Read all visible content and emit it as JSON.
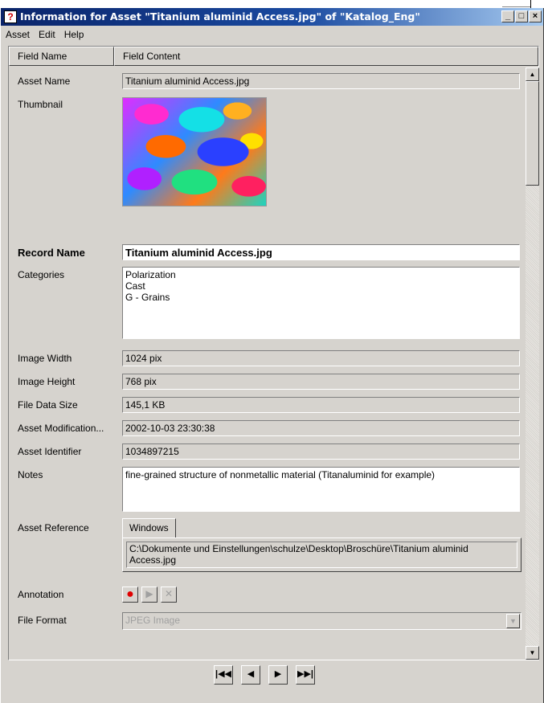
{
  "window": {
    "title": "Information for Asset \"Titanium aluminid Access.jpg\" of \"Katalog_Eng\"",
    "controls": {
      "minimize": "_",
      "maximize": "□",
      "close": "×"
    }
  },
  "menu": [
    "Asset",
    "Edit",
    "Help"
  ],
  "grid": {
    "header": {
      "field_name": "Field Name",
      "field_content": "Field Content"
    }
  },
  "fields": {
    "asset_name": {
      "label": "Asset Name",
      "value": "Titanium aluminid Access.jpg"
    },
    "thumbnail": {
      "label": "Thumbnail"
    },
    "record_name": {
      "label": "Record Name",
      "value": "Titanium aluminid Access.jpg"
    },
    "categories": {
      "label": "Categories",
      "values": [
        "Polarization",
        "Cast",
        "G - Grains"
      ]
    },
    "image_width": {
      "label": "Image Width",
      "value": "1024 pix"
    },
    "image_height": {
      "label": "Image Height",
      "value": "768 pix"
    },
    "file_data_size": {
      "label": "File Data Size",
      "value": "145,1 KB"
    },
    "asset_modification": {
      "label": "Asset Modification...",
      "value": "2002-10-03 23:30:38"
    },
    "asset_identifier": {
      "label": "Asset Identifier",
      "value": "1034897215"
    },
    "notes": {
      "label": "Notes",
      "value": "fine-grained structure of nonmetallic material (Titanaluminid for example)"
    },
    "asset_reference": {
      "label": "Asset Reference",
      "tab": "Windows",
      "value": "C:\\Dokumente und Einstellungen\\schulze\\Desktop\\Broschüre\\Titanium aluminid Access.jpg"
    },
    "annotation": {
      "label": "Annotation"
    },
    "file_format": {
      "label": "File Format",
      "value": "JPEG Image"
    }
  },
  "icons": {
    "app": "catalog-app-icon",
    "annotation_add": "red-dot-icon",
    "annotation_play": "play-icon",
    "annotation_delete": "x-box-icon",
    "nav_first": "first-record-icon",
    "nav_prev": "prev-record-icon",
    "nav_next": "next-record-icon",
    "nav_last": "last-record-icon"
  },
  "colors": {
    "title_bar": "#0a246a",
    "window_bg": "#d6d3ce"
  }
}
